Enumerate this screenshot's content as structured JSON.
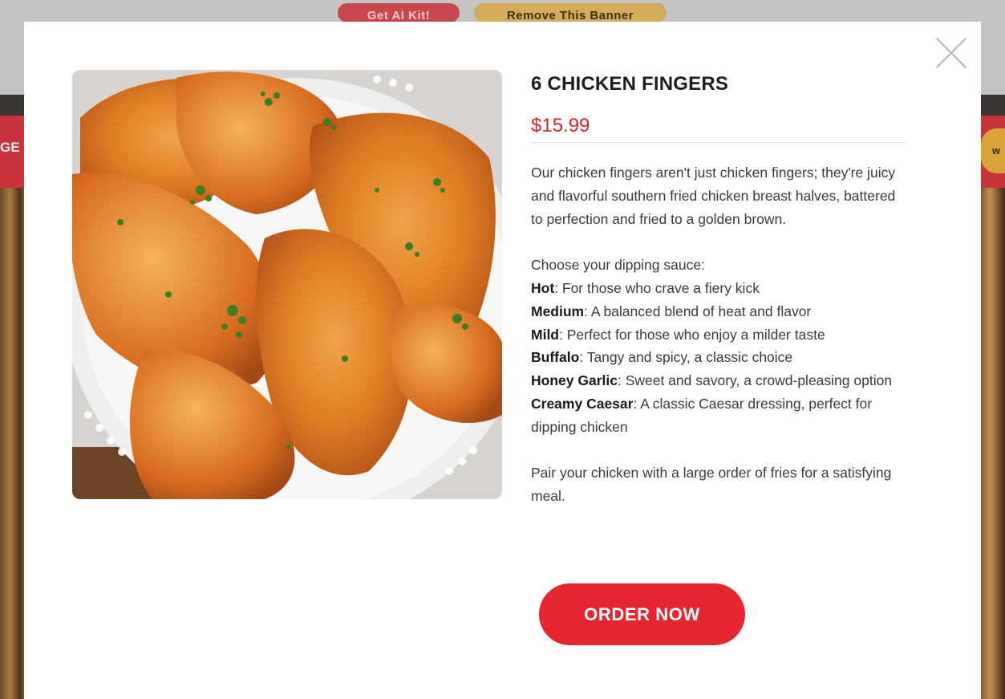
{
  "banner": {
    "ai_kit_label": "Get AI Kit!",
    "remove_label": "Remove This Banner"
  },
  "background": {
    "nav_left_fragment": "GE",
    "nav_right_fragment": "w"
  },
  "product": {
    "title": "6 CHICKEN FINGERS",
    "price": "$15.99",
    "description": "Our chicken fingers aren't just chicken fingers; they're juicy and flavorful southern fried chicken breast halves, battered to perfection and fried to a golden brown.",
    "sauce_intro": "Choose your dipping sauce:",
    "sauces": [
      {
        "name": "Hot",
        "desc": ": For those who crave a fiery kick"
      },
      {
        "name": "Medium",
        "desc": ": A balanced blend of heat and flavor"
      },
      {
        "name": "Mild",
        "desc": ": Perfect for those who enjoy a milder taste"
      },
      {
        "name": "Buffalo",
        "desc": ": Tangy and spicy, a classic choice"
      },
      {
        "name": "Honey Garlic",
        "desc": ": Sweet and savory, a crowd-pleasing option"
      },
      {
        "name": "Creamy Caesar",
        "desc": ": A classic Caesar dressing, perfect for dipping chicken"
      }
    ],
    "pairing": "Pair your chicken with a large order of fries for a satisfying meal.",
    "order_label": "ORDER NOW"
  },
  "colors": {
    "accent": "#e32630",
    "price": "#d3242f"
  },
  "icons": {
    "close": "close-icon"
  }
}
